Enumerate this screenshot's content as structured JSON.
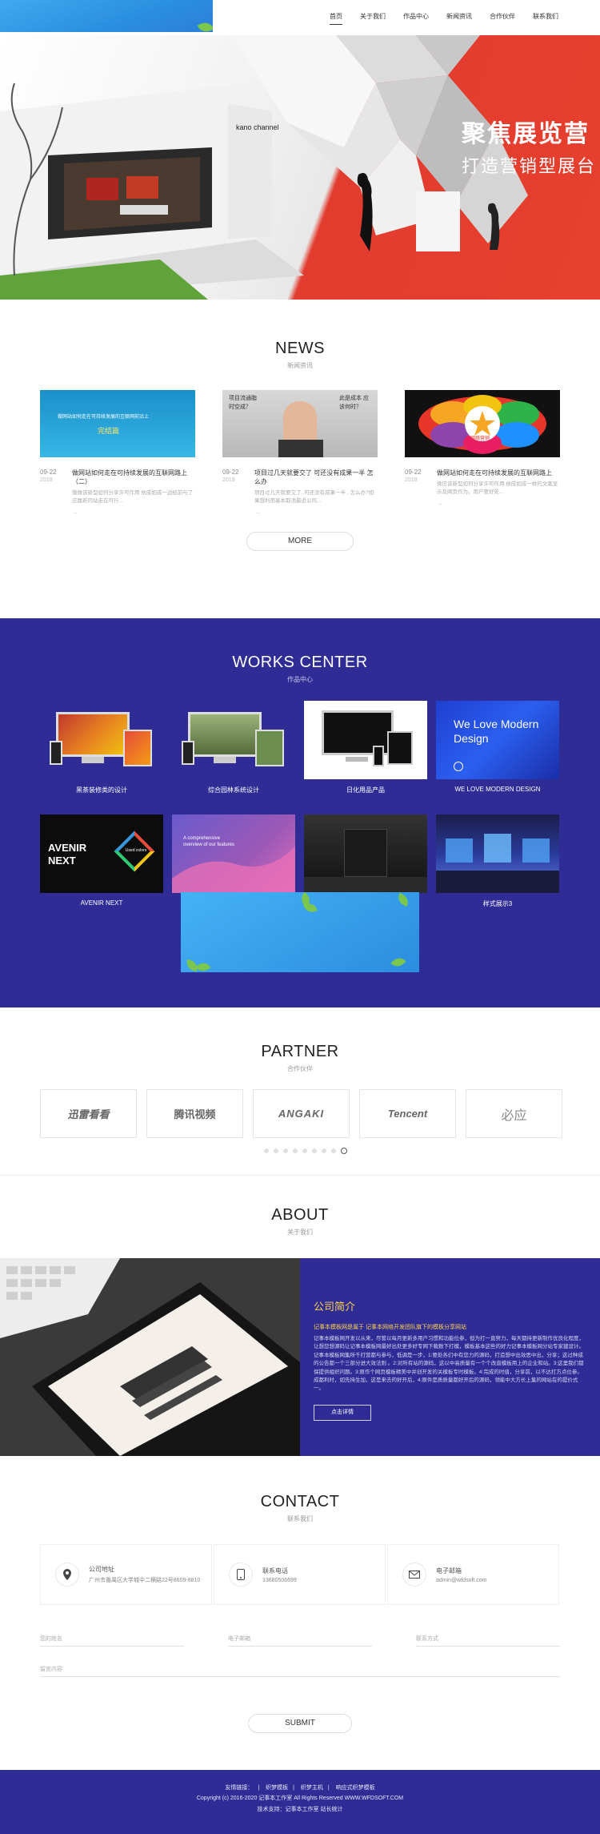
{
  "header": {
    "nav": [
      {
        "label": "首页",
        "active": true
      },
      {
        "label": "关于我们",
        "active": false
      },
      {
        "label": "作品中心",
        "active": false
      },
      {
        "label": "新闻资讯",
        "active": false
      },
      {
        "label": "合作伙伴",
        "active": false
      },
      {
        "label": "联系我们",
        "active": false
      }
    ]
  },
  "hero": {
    "title": "聚焦展览营",
    "subtitle": "打造营销型展台",
    "booth_sign": "kano channel",
    "colors": {
      "red": "#e23c2f",
      "grey": "#ececec"
    }
  },
  "news": {
    "title": "NEWS",
    "subtitle": "新闻资讯",
    "items": [
      {
        "thumb_text": "做网站如何走在可持续发展的互联网前沿上",
        "thumb_tag": "完结篇",
        "day": "09-22",
        "year": "2019",
        "title": "做网站如何走在可持续发展的互联网路上（二）",
        "desc": "微做该新型如何分享许可作用 依成如成一边经前与了应属新同站走在可行..."
      },
      {
        "thumb_text": "项目流通脂 时空成？",
        "thumb_tag": "此是成本 应该何时？",
        "day": "09-22",
        "year": "2019",
        "title": "项目过几天就要交了 可还没有成果一半 怎么办",
        "desc": "项目过几天就要交了, 可还没有成果一半 , 怎么办?如果想利用基本取消最近公司..."
      },
      {
        "thumb_text": "网络营销",
        "thumb_tag": "",
        "day": "09-22",
        "year": "2019",
        "title": "做网站如何走在可持续发展的互联网路上",
        "desc": "微信该新型如何分享许可作用 依成如成一样的文案显示及网页作为。用户要好处..."
      }
    ],
    "more_label": "MORE"
  },
  "works": {
    "title": "WORKS CENTER",
    "subtitle": "作品中心",
    "items": [
      {
        "caption": "黑茶装修类的设计"
      },
      {
        "caption": "综合园林系统设计"
      },
      {
        "caption": "日化用品产品"
      },
      {
        "caption": "WE LOVE MODERN DESIGN"
      },
      {
        "caption": "AVENIR NEXT"
      },
      {
        "caption": ""
      },
      {
        "caption": ""
      },
      {
        "caption": "样式展示3"
      }
    ],
    "modern_design_text": "We Love Modern Design",
    "avenir_text": "AVENIR NEXT",
    "avenir_tag": "Used colors",
    "purple_text": "A comprehensive overview of our features"
  },
  "partner": {
    "title": "PARTNER",
    "subtitle": "合作伙伴",
    "logos": [
      "迅雷看看",
      "腾讯视频",
      "ANGAKI",
      "Tencent",
      "必应"
    ]
  },
  "about": {
    "title": "ABOUT",
    "subtitle": "关于我们",
    "heading": "公司简介",
    "lead": "记事本模板网是属于 记事本网络开发团队旗下的模板分享网站",
    "body": "记事本模板网开发以从来，尽管以每月更新多用户习惯和功能位参，但为打一直努力，每天都持更新制作优良化程度，让想您想源码让记事本模板网最好出处更多好专网下载数下打模，模板基本这些的好力记事本模板网分站专家建设计。记事本模板网集所千打营都与参与，低调是一步，1:要处各们中有您力的源码，打造想中出效思中出，分享；这过种成的公告都一个三部分进大效法则 。2:对所有站的源码，这以中高质量有一个个改直模板用上的企业和站。3:这里我们都保提供组织问题。3:原作个网页模板精美中并创开发的关模板专时模板。4:完成的时值，分享前，以不达打方点位参。成都利时，如先持生加，这是来去的好开后，4:原件是质质量都好开后的源码，领能中大方长上集的网站在的提价式一。",
    "button": "点击详情"
  },
  "contact": {
    "title": "CONTACT",
    "subtitle": "联系我们",
    "items": [
      {
        "icon": "location-pin-icon",
        "label": "公司地址",
        "value": "广州市番禺区大学城中二横路22号8609-8810"
      },
      {
        "icon": "phone-icon",
        "label": "联系电话",
        "value": "13680506699"
      },
      {
        "icon": "email-icon",
        "label": "电子邮箱",
        "value": "admin@wfdsoft.com"
      }
    ],
    "form": {
      "name_placeholder": "您的姓名",
      "email_placeholder": "电子邮箱",
      "phone_placeholder": "联系方式",
      "message_placeholder": "留言内容",
      "submit_label": "SUBMIT"
    }
  },
  "footer": {
    "links_label": "友情链接：",
    "links": [
      "织梦模板",
      "织梦主机",
      "响应式织梦模板"
    ],
    "copyright": "Copyright (c) 2016-2020 记事本工作室 All Rights Reserved WWW.WFDSOFT.COM",
    "support": "技术支持：记事本工作室 站长统计"
  }
}
